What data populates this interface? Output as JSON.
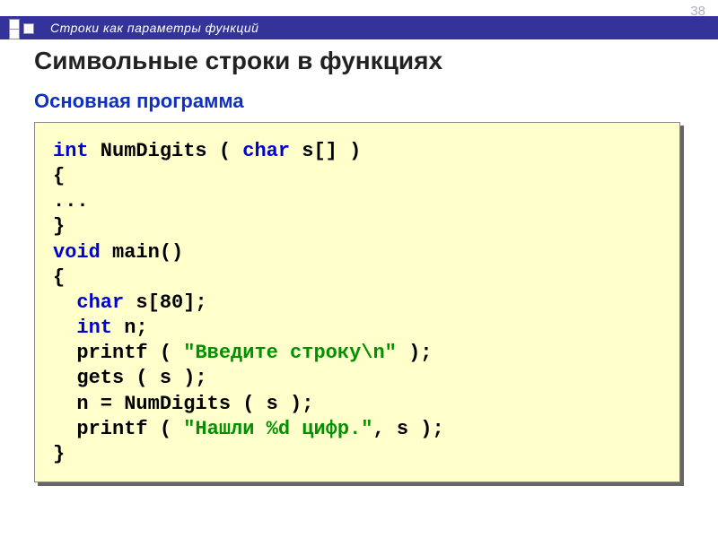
{
  "page_number": "38",
  "banner_title": "Строки как параметры функций",
  "heading": "Символьные строки в функциях",
  "subheading": "Основная программа",
  "code": {
    "t1a": "int",
    "t1b": " NumDigits ( ",
    "t1c": "char",
    "t1d": " s[] )",
    "t2": "{",
    "t3": "...",
    "t4": "}",
    "t5a": "void",
    "t5b": " main()",
    "t6": "{",
    "t7a": "char",
    "t7b": " s[80];",
    "t8a": "int",
    "t8b": " n;",
    "t9a": "printf ( ",
    "t9b": "\"Введите строку\\n\"",
    "t9c": " );",
    "t10": "gets ( s );",
    "t11": "n = NumDigits ( s );",
    "t12a": "printf ( ",
    "t12b": "\"Нашли %d цифр.\"",
    "t12c": ", s );",
    "t13": "}"
  }
}
